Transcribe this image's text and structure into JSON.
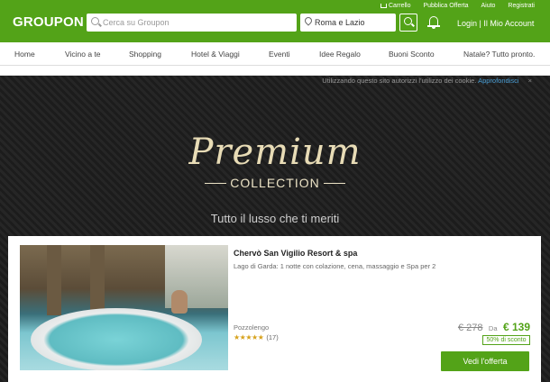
{
  "header": {
    "logo": "GROUPON",
    "links": [
      "Carrello",
      "Pubblica Offerta",
      "Aiuto",
      "Registrati"
    ],
    "search_placeholder": "Cerca su Groupon",
    "location_value": "Roma e Lazio",
    "account_label": "Login | Il Mio Account"
  },
  "nav": {
    "items": [
      "Home",
      "Vicino a te",
      "Shopping",
      "Hotel & Viaggi",
      "Eventi",
      "Idee Regalo",
      "Buoni Sconto",
      "Natale? Tutto pronto."
    ]
  },
  "cookie_banner": {
    "text": "Utilizzando questo sito autorizzi l'utilizzo dei cookie.",
    "link": "Approfondisci",
    "close": "×"
  },
  "hero": {
    "premium": "Premium",
    "collection": "COLLECTION",
    "tagline": "Tutto il lusso che ti meriti"
  },
  "deal": {
    "title": "Chervò San Vigilio Resort & spa",
    "subtitle": "Lago di Garda: 1 notte con colazione, cena, massaggio e Spa per 2",
    "location": "Pozzolengo",
    "rating": 4.5,
    "stars": "★★★★★",
    "reviews": "(17)",
    "old_price": "€ 278",
    "from_label": "Da",
    "new_price": "€ 139",
    "discount": "50% di sconto",
    "cta": "Vedi l'offerta"
  },
  "colors": {
    "brand_green": "#53a318",
    "link_blue": "#4a9fd6",
    "star_gold": "#d7a21c"
  }
}
